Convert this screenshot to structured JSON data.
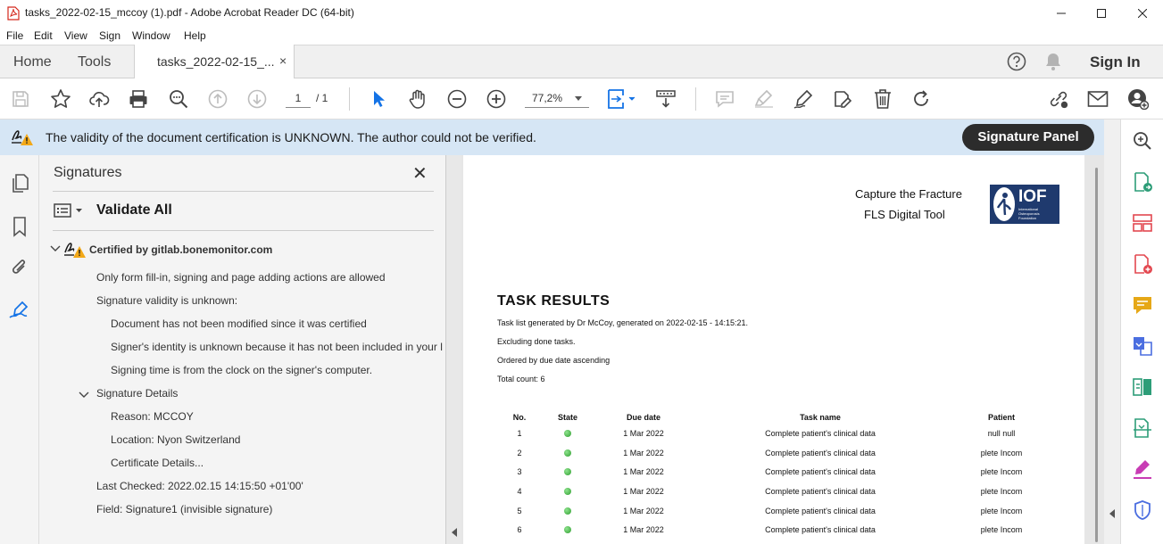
{
  "window": {
    "title": "tasks_2022-02-15_mccoy (1).pdf - Adobe Acrobat Reader DC (64-bit)",
    "icon": "pdf-icon"
  },
  "menu": [
    "File",
    "Edit",
    "View",
    "Sign",
    "Window",
    "Help"
  ],
  "tabs": {
    "home": "Home",
    "tools": "Tools",
    "document": "tasks_2022-02-15_...",
    "close": "×",
    "sign_in": "Sign In"
  },
  "toolbar": {
    "page_current": "1",
    "page_total": "/ 1",
    "zoom": "77,2%"
  },
  "notification": {
    "message": "The validity of the document certification is UNKNOWN. The author could not be verified.",
    "signature_panel": "Signature Panel",
    "background": "#d6e6f5"
  },
  "signatures": {
    "header": "Signatures",
    "close": "✕",
    "validate_all": "Validate All",
    "certified_by": "Certified by gitlab.bonemonitor.com",
    "permissions": "Only form fill-in, signing and page adding actions are allowed",
    "validity": "Signature validity is unknown:",
    "not_modified": "Document has not been modified since it was certified",
    "identity_unknown": "Signer's identity is unknown because it has not been included in your l",
    "signing_time": "Signing time is from the clock on the signer's computer.",
    "details_label": "Signature Details",
    "reason": "Reason:  MCCOY",
    "location": "Location: Nyon Switzerland",
    "certificate": "Certificate Details...",
    "last_checked": "Last Checked: 2022.02.15 14:15:50 +01'00'",
    "field": "Field: Signature1 (invisible signature)"
  },
  "document": {
    "header_line1": "Capture the Fracture",
    "header_line2": "FLS Digital Tool",
    "logo_text": "IOF",
    "logo_sub": "International Osteoporosis Foundation",
    "title": "TASK RESULTS",
    "meta": [
      "Task list generated by Dr McCoy, generated on 2022-02-15 - 14:15:21.",
      "Excluding done tasks.",
      "Ordered by due date ascending",
      "Total count: 6"
    ],
    "columns": [
      "No.",
      "State",
      "Due date",
      "Task name",
      "Patient"
    ],
    "rows": [
      {
        "no": "1",
        "due": "1 Mar 2022",
        "task": "Complete patient's clinical data",
        "patient": "null null"
      },
      {
        "no": "2",
        "due": "1 Mar 2022",
        "task": "Complete patient's clinical data",
        "patient": "plete Incom"
      },
      {
        "no": "3",
        "due": "1 Mar 2022",
        "task": "Complete patient's clinical data",
        "patient": "plete Incom"
      },
      {
        "no": "4",
        "due": "1 Mar 2022",
        "task": "Complete patient's clinical data",
        "patient": "plete Incom"
      },
      {
        "no": "5",
        "due": "1 Mar 2022",
        "task": "Complete patient's clinical data",
        "patient": "plete Incom"
      },
      {
        "no": "6",
        "due": "1 Mar 2022",
        "task": "Complete patient's clinical data",
        "patient": "plete Incom"
      }
    ],
    "state_color": "#3cb33c",
    "logo_color": "#1f3a6e"
  },
  "colors": {
    "accent_blue": "#1473e6",
    "warning": "#f2a818",
    "right_tools": [
      "#2d9d78",
      "#e34850",
      "#e34850",
      "#e6a817",
      "#4b6ee0",
      "#2d9d78",
      "#2d9d78",
      "#c83cb4",
      "#4b6ee0"
    ]
  }
}
